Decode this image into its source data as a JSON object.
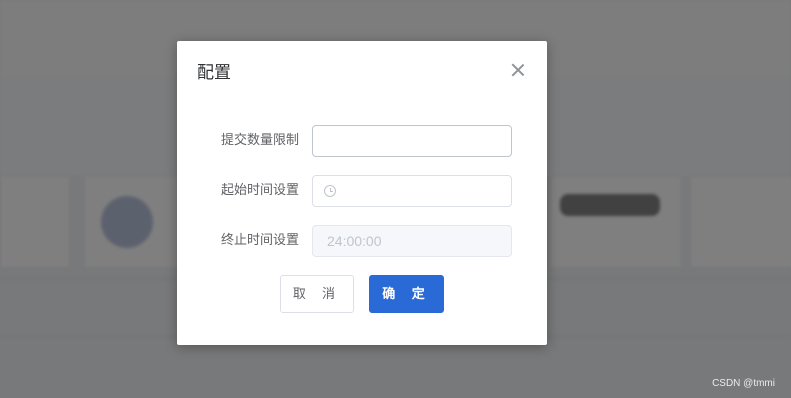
{
  "dialog": {
    "title": "配置",
    "close_icon": "close-icon",
    "fields": [
      {
        "label": "提交数量限制",
        "value": "",
        "placeholder": ""
      },
      {
        "label": "起始时间设置",
        "value": "",
        "icon": "clock-icon"
      },
      {
        "label": "终止时间设置",
        "value": "24:00:00",
        "disabled": true
      }
    ],
    "cancel_label": "取 消",
    "confirm_label": "确 定",
    "colors": {
      "primary": "#2a6ad6",
      "overlay": "rgba(0,0,0,0.5)"
    }
  },
  "watermark": "CSDN @tmmi"
}
